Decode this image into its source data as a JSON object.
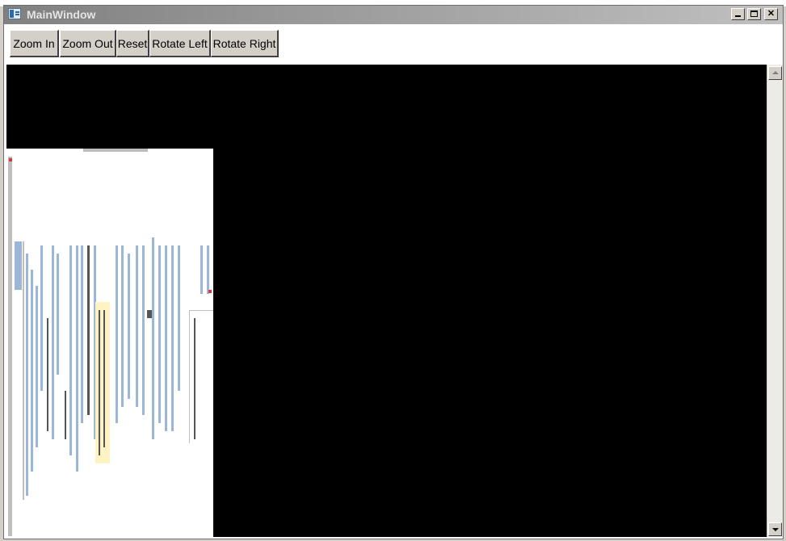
{
  "window": {
    "title": "MainWindow"
  },
  "toolbar": {
    "zoom_in": "Zoom In",
    "zoom_out": "Zoom Out",
    "reset": "Reset",
    "rotate_left": "Rotate Left",
    "rotate_right": "Rotate Right"
  },
  "colors": {
    "canvas_background": "#000000",
    "titlebar_start": "#808080",
    "button_face": "#d4d0c8"
  },
  "icons": {
    "app": "window-app-icon",
    "minimize": "minimize-icon",
    "maximize": "maximize-icon",
    "close": "close-icon",
    "scroll_up": "arrow-up-icon",
    "scroll_down": "arrow-down-icon"
  }
}
